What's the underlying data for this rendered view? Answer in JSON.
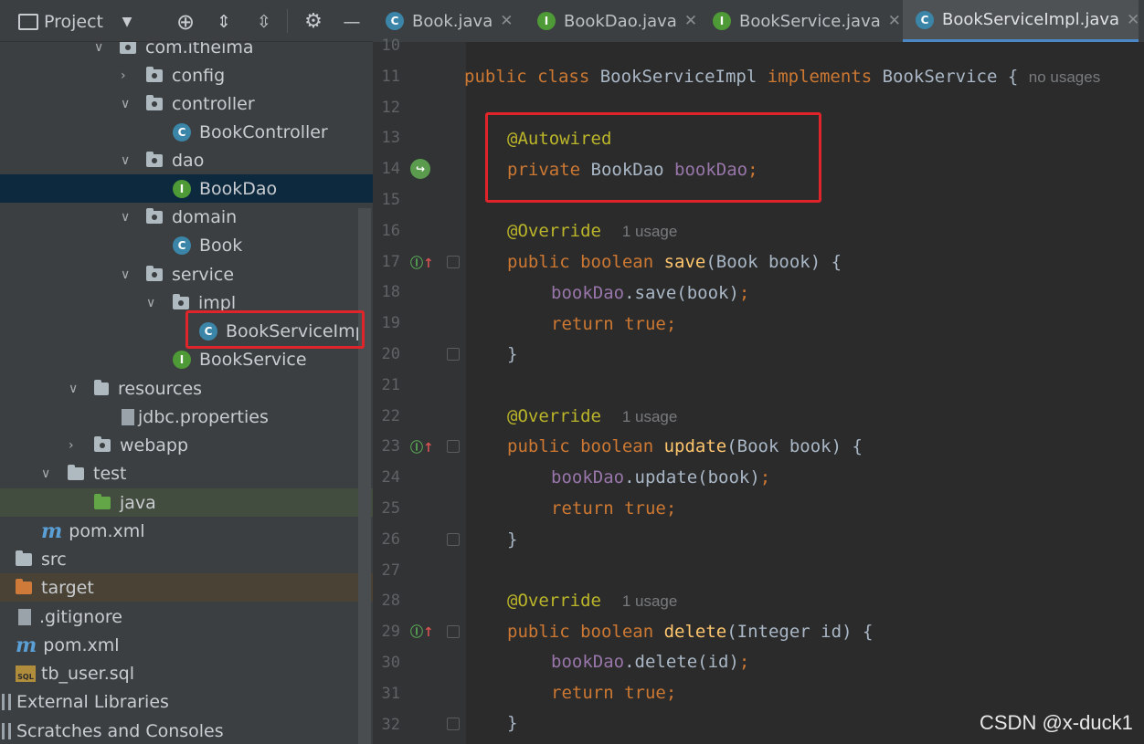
{
  "toolbar": {
    "project_label": "Project",
    "dropdown_icon": "chevron-down-icon",
    "locate_icon": "crosshair-icon",
    "expand_icon": "expand-all-icon",
    "collapse_icon": "collapse-all-icon",
    "settings_icon": "gear-icon",
    "hide_icon": "minimize-icon"
  },
  "tabs": [
    {
      "label": "Book.java",
      "type": "class",
      "close": "✕"
    },
    {
      "label": "BookDao.java",
      "type": "interface",
      "close": "✕"
    },
    {
      "label": "BookService.java",
      "type": "interface",
      "close": "✕"
    },
    {
      "label": "BookServiceImpl.java",
      "type": "class",
      "close": "✕"
    }
  ],
  "tree": [
    {
      "label": "com.itheima",
      "icon": "package"
    },
    {
      "label": "config",
      "icon": "package"
    },
    {
      "label": "controller",
      "icon": "package"
    },
    {
      "label": "BookController",
      "icon": "class",
      "badge": "C"
    },
    {
      "label": "dao",
      "icon": "package"
    },
    {
      "label": "BookDao",
      "icon": "interface",
      "badge": "I"
    },
    {
      "label": "domain",
      "icon": "package"
    },
    {
      "label": "Book",
      "icon": "class",
      "badge": "C"
    },
    {
      "label": "service",
      "icon": "package"
    },
    {
      "label": "impl",
      "icon": "package"
    },
    {
      "label": "BookServiceImpl",
      "icon": "class",
      "badge": "C"
    },
    {
      "label": "BookService",
      "icon": "interface",
      "badge": "I"
    },
    {
      "label": "resources",
      "icon": "resources-folder"
    },
    {
      "label": "jdbc.properties",
      "icon": "properties-file"
    },
    {
      "label": "webapp",
      "icon": "web-folder"
    },
    {
      "label": "test",
      "icon": "folder"
    },
    {
      "label": "java",
      "icon": "test-source-folder"
    },
    {
      "label": "pom.xml",
      "icon": "maven"
    },
    {
      "label": "src",
      "icon": "folder"
    },
    {
      "label": "target",
      "icon": "excluded-folder"
    },
    {
      "label": ".gitignore",
      "icon": "file"
    },
    {
      "label": "pom.xml",
      "icon": "maven"
    },
    {
      "label": "tb_user.sql",
      "icon": "sql-file"
    },
    {
      "label": "External Libraries",
      "icon": "library"
    },
    {
      "label": "Scratches and Consoles",
      "icon": "scratches"
    }
  ],
  "editor": {
    "line_numbers": [
      "10",
      "11",
      "12",
      "13",
      "14",
      "15",
      "16",
      "17",
      "18",
      "19",
      "20",
      "21",
      "22",
      "23",
      "24",
      "25",
      "26",
      "27",
      "28",
      "29",
      "30",
      "31",
      "32"
    ],
    "lines": {
      "l11": {
        "kw1": "public class ",
        "name": "BookServiceImpl ",
        "kw2": "implements ",
        "iface": "BookService {",
        "hint": "no usages"
      },
      "l13": {
        "ann": "@Autowired"
      },
      "l14": {
        "kw": "private ",
        "type": "BookDao ",
        "field": "bookDao",
        "semi": ";"
      },
      "l16": {
        "ann": "@Override",
        "hint": "1 usage"
      },
      "l17": {
        "kw": "public boolean ",
        "m": "save",
        "args": "(Book book) {"
      },
      "l18": {
        "field": "bookDao",
        "call": ".save(book)",
        "semi": ";"
      },
      "l19": {
        "kw": "return true",
        "semi": ";"
      },
      "l20": {
        "brace": "}"
      },
      "l22": {
        "ann": "@Override",
        "hint": "1 usage"
      },
      "l23": {
        "kw": "public boolean ",
        "m": "update",
        "args": "(Book book) {"
      },
      "l24": {
        "field": "bookDao",
        "call": ".update(book)",
        "semi": ";"
      },
      "l25": {
        "kw": "return true",
        "semi": ";"
      },
      "l26": {
        "brace": "}"
      },
      "l28": {
        "ann": "@Override",
        "hint": "1 usage"
      },
      "l29": {
        "kw": "public boolean ",
        "m": "delete",
        "args": "(Integer id) {"
      },
      "l30": {
        "field": "bookDao",
        "call": ".delete(id)",
        "semi": ";"
      },
      "l31": {
        "kw": "return true",
        "semi": ";"
      },
      "l32": {
        "brace": "}"
      }
    }
  },
  "watermark": "CSDN @x-duck1",
  "colors": {
    "highlight_box": "#e0252a",
    "accent": "#4a88c7"
  }
}
